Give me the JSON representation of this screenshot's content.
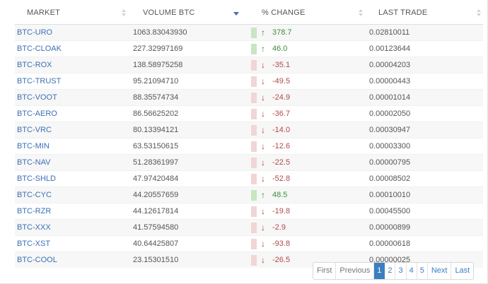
{
  "table": {
    "columns": [
      {
        "label": "MARKET"
      },
      {
        "label": "VOLUME BTC"
      },
      {
        "label": "% CHANGE"
      },
      {
        "label": "LAST TRADE"
      }
    ],
    "sorted_column": "VOLUME BTC",
    "rows": [
      {
        "market": "BTC-URO",
        "volume": "1063.83043930",
        "change": "378.7",
        "direction": "up",
        "last": "0.02810011"
      },
      {
        "market": "BTC-CLOAK",
        "volume": "227.32997169",
        "change": "46.0",
        "direction": "up",
        "last": "0.00123644"
      },
      {
        "market": "BTC-ROX",
        "volume": "138.58975258",
        "change": "-35.1",
        "direction": "down",
        "last": "0.00004203"
      },
      {
        "market": "BTC-TRUST",
        "volume": "95.21094710",
        "change": "-49.5",
        "direction": "down",
        "last": "0.00000443"
      },
      {
        "market": "BTC-VOOT",
        "volume": "88.35574734",
        "change": "-24.9",
        "direction": "down",
        "last": "0.00001014"
      },
      {
        "market": "BTC-AERO",
        "volume": "86.56625202",
        "change": "-36.7",
        "direction": "down",
        "last": "0.00002050"
      },
      {
        "market": "BTC-VRC",
        "volume": "80.13394121",
        "change": "-14.0",
        "direction": "down",
        "last": "0.00030947"
      },
      {
        "market": "BTC-MIN",
        "volume": "63.53150615",
        "change": "-12.6",
        "direction": "down",
        "last": "0.00003300"
      },
      {
        "market": "BTC-NAV",
        "volume": "51.28361997",
        "change": "-22.5",
        "direction": "down",
        "last": "0.00000795"
      },
      {
        "market": "BTC-SHLD",
        "volume": "47.97420484",
        "change": "-52.8",
        "direction": "down",
        "last": "0.00008502"
      },
      {
        "market": "BTC-CYC",
        "volume": "44.20557659",
        "change": "48.5",
        "direction": "up",
        "last": "0.00010010"
      },
      {
        "market": "BTC-RZR",
        "volume": "44.12617814",
        "change": "-19.8",
        "direction": "down",
        "last": "0.00045500"
      },
      {
        "market": "BTC-XXX",
        "volume": "41.57594580",
        "change": "-2.9",
        "direction": "down",
        "last": "0.00000899"
      },
      {
        "market": "BTC-XST",
        "volume": "40.64425807",
        "change": "-93.8",
        "direction": "down",
        "last": "0.00000618"
      },
      {
        "market": "BTC-COOL",
        "volume": "23.15301510",
        "change": "-26.5",
        "direction": "down",
        "last": "0.00000025"
      }
    ]
  },
  "pagination": {
    "first": "First",
    "previous": "Previous",
    "pages": [
      "1",
      "2",
      "3",
      "4",
      "5"
    ],
    "current": "1",
    "next": "Next",
    "last": "Last"
  },
  "colors": {
    "positive": "#2e8b2e",
    "negative": "#c0392b",
    "link": "#3b6fb6",
    "active_page": "#3a7fc1"
  },
  "icons": {
    "up": "arrow-up-icon",
    "down": "arrow-down-icon",
    "sort": "sort-icon"
  }
}
